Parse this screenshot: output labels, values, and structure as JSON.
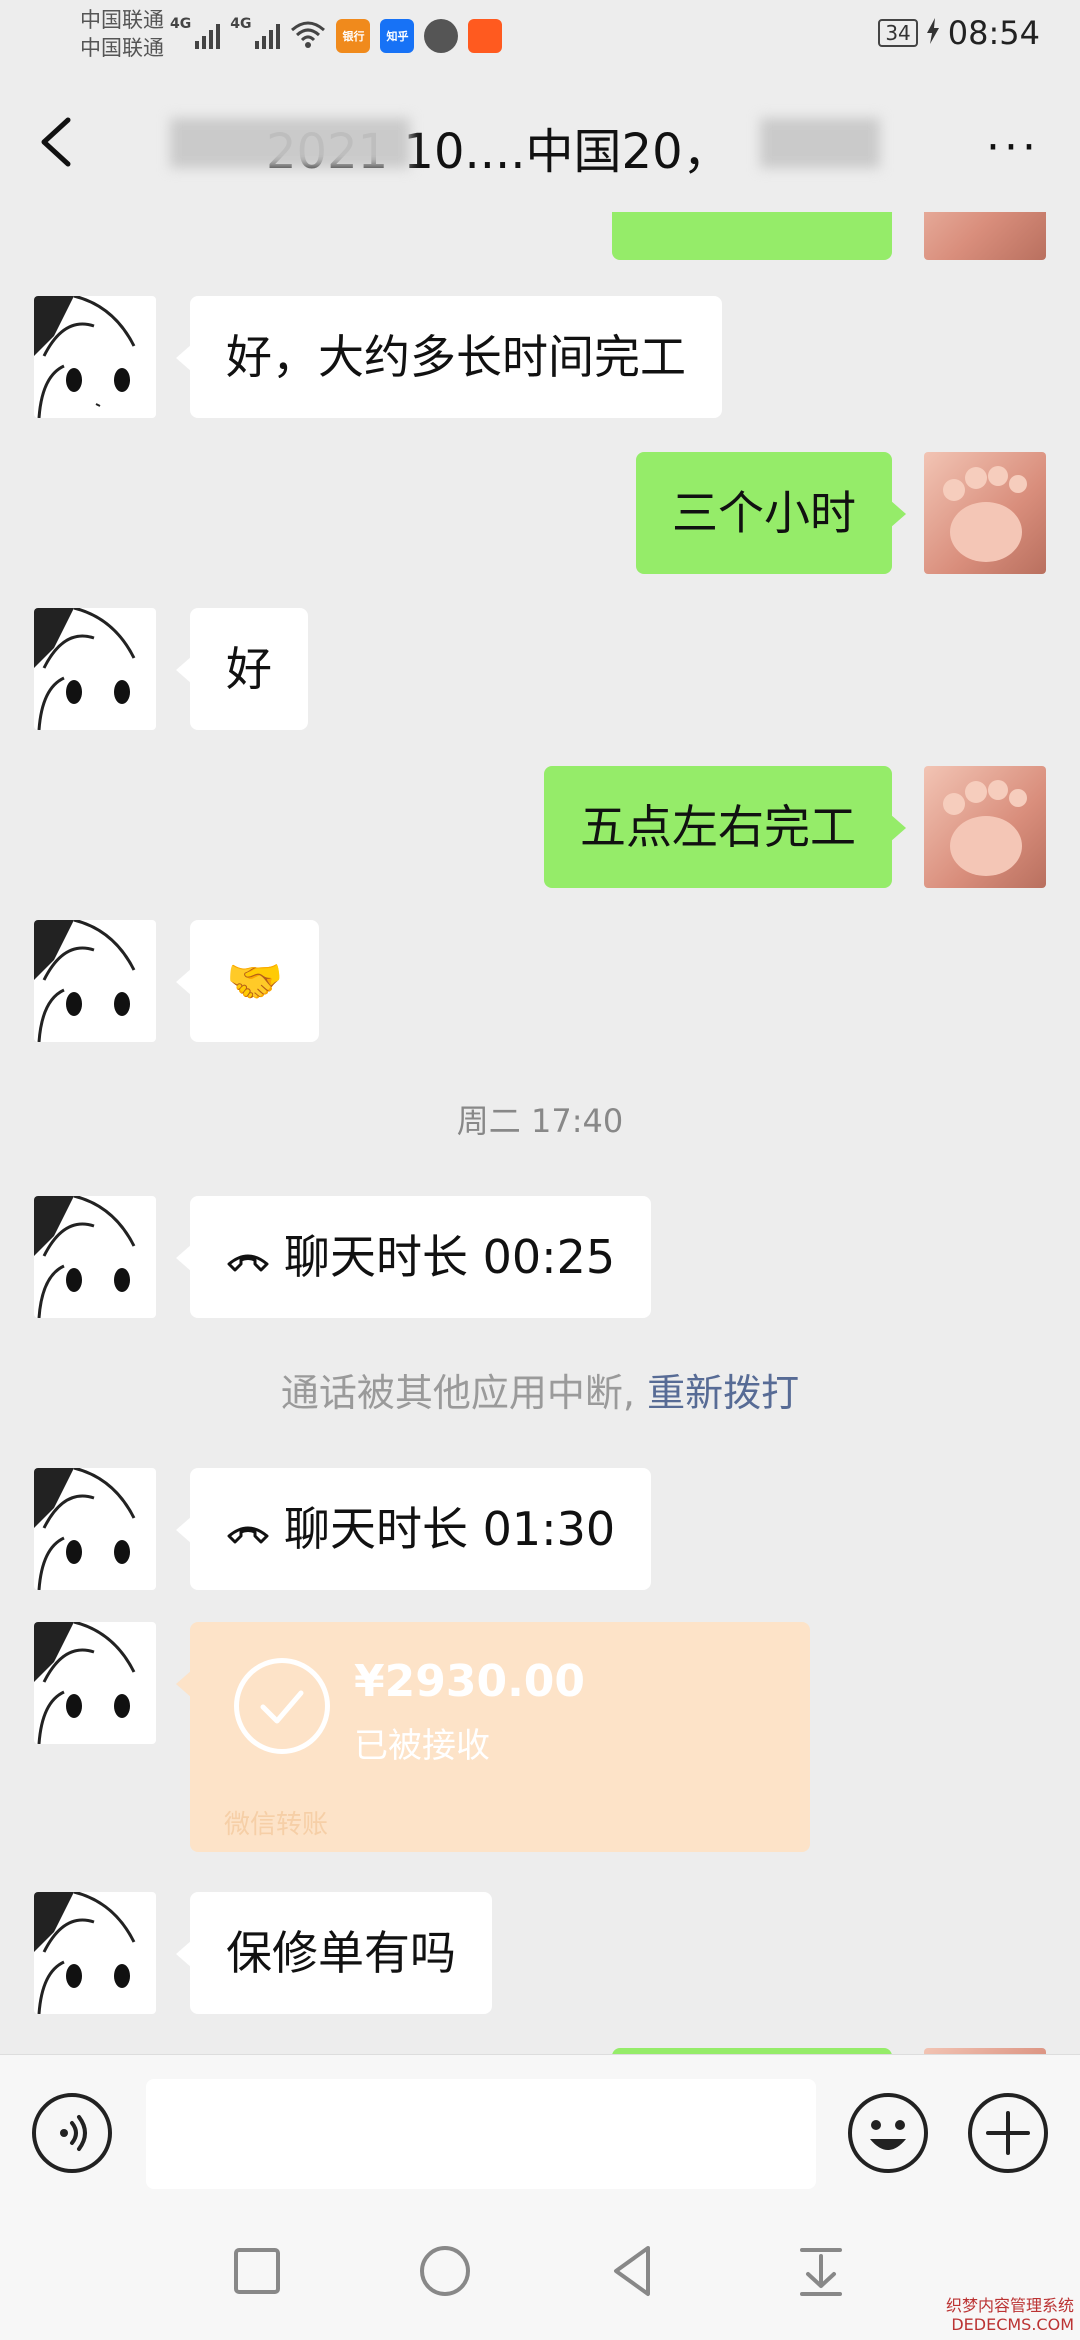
{
  "status_bar": {
    "carrier_top": "中国联通",
    "carrier_bottom": "中国联通",
    "network_1": "4G",
    "network_2": "4G",
    "app_badges": [
      {
        "icon": "bank-app-icon",
        "label": "银行",
        "color": "#f08a1c"
      },
      {
        "icon": "zhihu-app-icon",
        "label": "知乎",
        "color": "#1772f6"
      },
      {
        "icon": "browser-app-icon",
        "label": "",
        "color": "#555555"
      },
      {
        "icon": "taobao-app-icon",
        "label": "",
        "color": "#ff5a1f"
      }
    ],
    "battery": "34",
    "time": "08:54"
  },
  "header": {
    "title": "2021 10....中国20，",
    "more_label": "···"
  },
  "messages": [
    {
      "text": "好，大约多长时间完工"
    },
    {
      "text": "三个小时"
    },
    {
      "text": "好"
    },
    {
      "text": "五点左右完工"
    },
    {
      "text": "🤝"
    },
    {
      "text": "聊天时长 00:25"
    },
    {
      "text": "聊天时长 01:30"
    },
    {
      "text": "保修单有吗"
    }
  ],
  "timestamp": "周二 17:40",
  "system_note": {
    "text": "通话被其他应用中断,",
    "action": "重新拨打"
  },
  "transfer": {
    "amount": "¥2930.00",
    "status": "已被接收",
    "label": "微信转账"
  },
  "colors": {
    "sent_bubble": "#95ec69",
    "received_bubble": "#ffffff",
    "background": "#ededed",
    "link": "#576b95",
    "transfer": "#fde3c8"
  },
  "watermark": {
    "line1": "织梦内容管理系统",
    "line2": "DEDECMS.COM"
  }
}
